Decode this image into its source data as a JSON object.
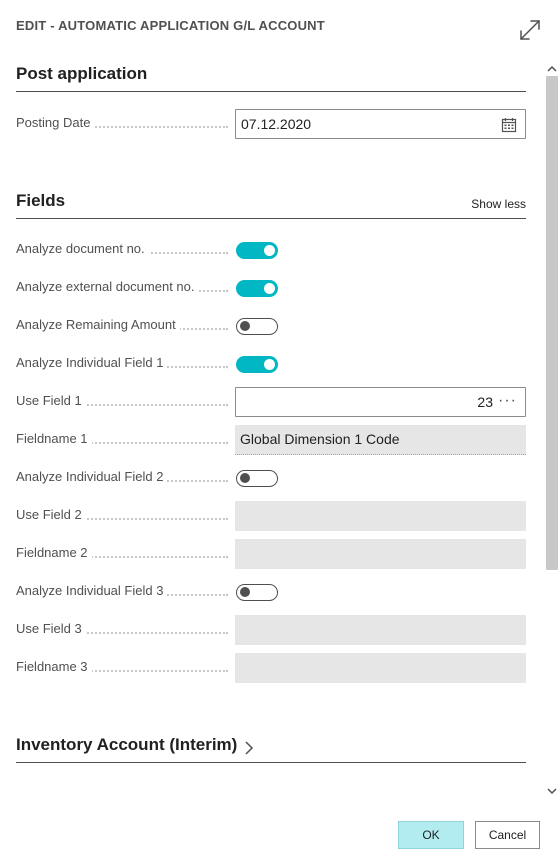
{
  "dialog": {
    "title": "EDIT - AUTOMATIC APPLICATION G/L ACCOUNT",
    "expand_icon": "expand-diagonal-icon"
  },
  "sections": {
    "post_application": {
      "title": "Post application",
      "posting_date_label": "Posting Date",
      "posting_date_value": "07.12.2020",
      "calendar_icon": "calendar-icon"
    },
    "fields": {
      "title": "Fields",
      "show_less": "Show less",
      "analyze_document_no": {
        "label": "Analyze document no.",
        "on": true
      },
      "analyze_external_document_no": {
        "label": "Analyze external document no.",
        "on": true
      },
      "analyze_remaining_amount": {
        "label": "Analyze Remaining Amount",
        "on": false
      },
      "analyze_individual_field_1": {
        "label": "Analyze Individual Field 1",
        "on": true
      },
      "use_field_1": {
        "label": "Use Field 1",
        "value": "23",
        "lookup": "···"
      },
      "fieldname_1": {
        "label": "Fieldname 1",
        "value": "Global Dimension 1 Code"
      },
      "analyze_individual_field_2": {
        "label": "Analyze Individual Field 2",
        "on": false
      },
      "use_field_2": {
        "label": "Use Field 2",
        "value": ""
      },
      "fieldname_2": {
        "label": "Fieldname 2",
        "value": ""
      },
      "analyze_individual_field_3": {
        "label": "Analyze Individual Field 3",
        "on": false
      },
      "use_field_3": {
        "label": "Use Field 3",
        "value": ""
      },
      "fieldname_3": {
        "label": "Fieldname 3",
        "value": ""
      }
    },
    "inventory_account": {
      "title": "Inventory Account (Interim)"
    }
  },
  "footer": {
    "ok_label": "OK",
    "cancel_label": "Cancel"
  },
  "colors": {
    "toggle_on": "#00b7c3",
    "ok_button": "#b3ecf0"
  }
}
